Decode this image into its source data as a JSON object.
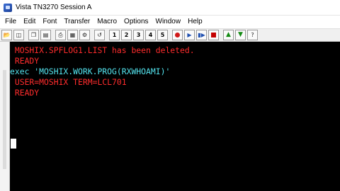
{
  "window": {
    "title": "Vista TN3270 Session A"
  },
  "menu": [
    "File",
    "Edit",
    "Font",
    "Transfer",
    "Macro",
    "Options",
    "Window",
    "Help"
  ],
  "toolbar": {
    "icons": [
      "open-icon",
      "save-icon",
      "copy-icon",
      "paste-icon",
      "print-icon",
      "print-setup-icon",
      "settings-icon",
      "reset-icon",
      "pf1-icon",
      "pf2-icon",
      "pf3-icon",
      "pf4-icon",
      "pf5-icon",
      "record-icon",
      "play-icon",
      "step-icon",
      "stop-icon",
      "page-up-icon",
      "page-down-icon",
      "help-icon"
    ],
    "key_labels": {
      "pf1": "1",
      "pf2": "2",
      "pf3": "3",
      "pf4": "4",
      "pf5": "5"
    }
  },
  "terminal": {
    "lines": [
      {
        "text": " MOSHIX.SPFLOG1.LIST has been deleted.",
        "color": "#ff2c2c"
      },
      {
        "text": " READY",
        "color": "#ff2c2c"
      },
      {
        "text": "exec 'MOSHIX.WORK.PROG(RXWHOAMI)'",
        "color": "#53e3ee"
      },
      {
        "text": " USER=MOSHIX TERM=LCL701",
        "color": "#ff2c2c"
      },
      {
        "text": " READY",
        "color": "#ff2c2c"
      }
    ]
  }
}
